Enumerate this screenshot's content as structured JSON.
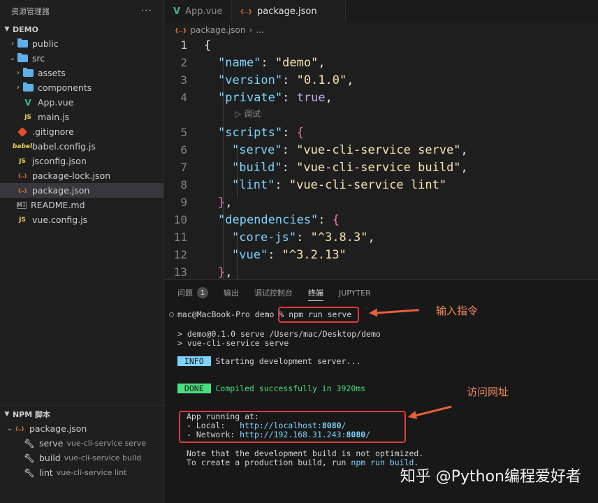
{
  "sidebar": {
    "header_title": "资源管理器",
    "more_label": "···",
    "project_title": "DEMO",
    "items": [
      {
        "label": "public",
        "type": "folder"
      },
      {
        "label": "src",
        "type": "folder"
      },
      {
        "label": "assets",
        "type": "folder"
      },
      {
        "label": "components",
        "type": "folder"
      },
      {
        "label": "App.vue",
        "type": "vue",
        "icon": "V"
      },
      {
        "label": "main.js",
        "type": "js",
        "icon": "JS"
      },
      {
        "label": ".gitignore",
        "type": "git"
      },
      {
        "label": "babel.config.js",
        "type": "babel",
        "icon": "babel"
      },
      {
        "label": "jsconfig.json",
        "type": "json",
        "icon": "JS"
      },
      {
        "label": "package-lock.json",
        "type": "json",
        "icon": "{..}"
      },
      {
        "label": "package.json",
        "type": "json",
        "icon": "{..}"
      },
      {
        "label": "README.md",
        "type": "md",
        "icon": "M↓"
      },
      {
        "label": "vue.config.js",
        "type": "js",
        "icon": "JS"
      }
    ],
    "npm": {
      "title": "NPM 脚本",
      "package": "package.json",
      "scripts": [
        {
          "name": "serve",
          "cmd": "vue-cli-service serve"
        },
        {
          "name": "build",
          "cmd": "vue-cli-service build"
        },
        {
          "name": "lint",
          "cmd": "vue-cli-service lint"
        }
      ]
    }
  },
  "tabs": [
    {
      "label": "App.vue",
      "icon": "V"
    },
    {
      "label": "package.json",
      "icon": "{..}"
    }
  ],
  "breadcrumb": {
    "file": "package.json",
    "sep": "›",
    "more": "..."
  },
  "editor": {
    "codelens": "▷ 调试",
    "line_numbers": [
      "1",
      "2",
      "3",
      "4",
      "5",
      "6",
      "7",
      "8",
      "9",
      "10",
      "11",
      "12",
      "13"
    ],
    "lines": [
      "{",
      "\"name\": \"demo\",",
      "\"version\": \"0.1.0\",",
      "\"private\": true,",
      "\"scripts\": {",
      "\"serve\": \"vue-cli-service serve\",",
      "\"build\": \"vue-cli-service build\",",
      "\"lint\": \"vue-cli-service lint\"",
      "},",
      "\"dependencies\": {",
      "\"core-js\": \"^3.8.3\",",
      "\"vue\": \"^3.2.13\"",
      "},"
    ]
  },
  "panel": {
    "tabs": [
      "问题",
      "输出",
      "调试控制台",
      "终端",
      "JUPYTER"
    ],
    "problems_count": "1",
    "terminal": {
      "prompt": "mac@MacBook-Pro demo % ",
      "command": "npm run serve",
      "out1": "> demo@0.1.0 serve /Users/mac/Desktop/demo",
      "out2": "> vue-cli-service serve",
      "info_tag": " INFO ",
      "info_text": " Starting development server...",
      "done_tag": " DONE ",
      "done_text": " Compiled successfully in 3920ms",
      "running": "App running at:",
      "local_label": "- Local:   ",
      "local_url_a": "http://localhost:",
      "local_port": "8080",
      "local_url_b": "/",
      "network_label": "- Network: ",
      "network_url_a": "http://192.168.31.243:",
      "network_port": "8080",
      "network_url_b": "/",
      "note1": "Note that the development build is not optimized.",
      "note2_a": "To create a production build, run ",
      "note2_b": "npm run build",
      "note2_c": "."
    }
  },
  "annotations": {
    "input_cmd": "输入指令",
    "visit_url": "访问网址"
  },
  "watermark": "知乎 @Python编程爱好者"
}
